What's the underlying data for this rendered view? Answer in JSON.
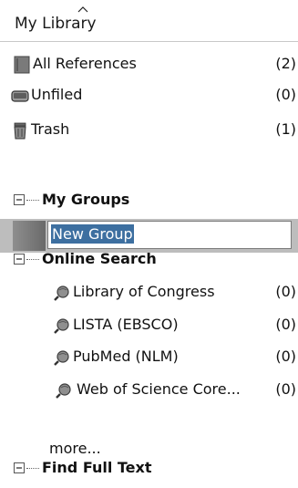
{
  "header": {
    "title": "My Library"
  },
  "library": {
    "items": [
      {
        "label": "All References",
        "count": "(2)",
        "icon": "book-icon"
      },
      {
        "label": "Unfiled",
        "count": "(0)",
        "icon": "box-icon"
      },
      {
        "label": "Trash",
        "count": "(1)",
        "icon": "trash-icon"
      }
    ]
  },
  "groups": {
    "title": "My Groups",
    "new_group_value": "New Group"
  },
  "online_search": {
    "title": "Online Search",
    "items": [
      {
        "label": "Library of Congress",
        "count": "(0)",
        "icon": "search-globe-icon"
      },
      {
        "label": "LISTA (EBSCO)",
        "count": "(0)",
        "icon": "search-globe-icon"
      },
      {
        "label": "PubMed (NLM)",
        "count": "(0)",
        "icon": "search-globe-icon"
      },
      {
        "label": "Web of Science Core...",
        "count": "(0)",
        "icon": "search-globe-icon"
      }
    ],
    "more_label": "more..."
  },
  "find_full_text": {
    "title": "Find Full Text"
  }
}
